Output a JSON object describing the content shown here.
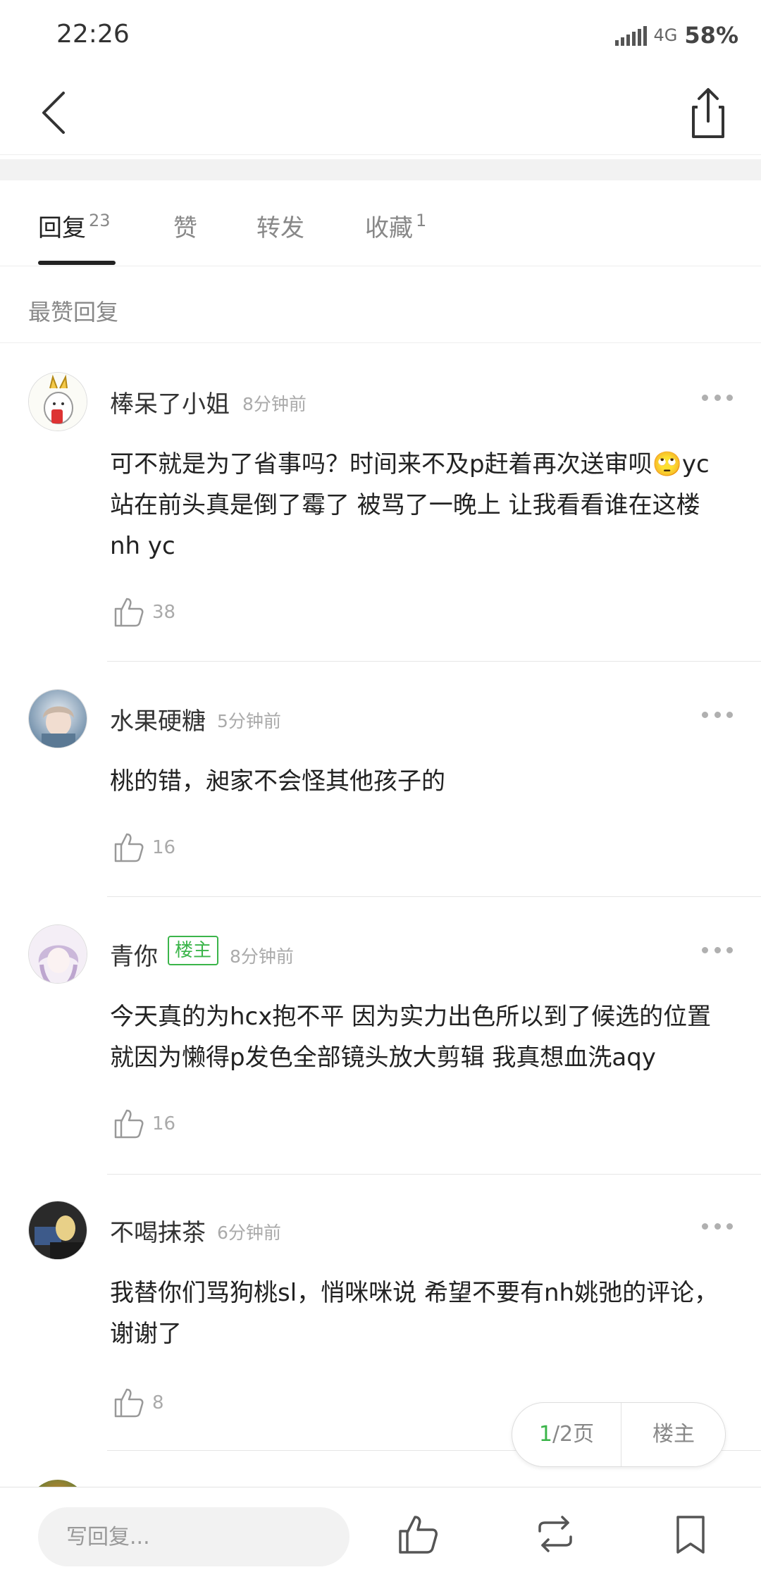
{
  "status": {
    "time": "22:26",
    "network": "4G",
    "battery": "58%"
  },
  "tabs": [
    {
      "label": "回复",
      "count": "23"
    },
    {
      "label": "赞",
      "count": ""
    },
    {
      "label": "转发",
      "count": ""
    },
    {
      "label": "收藏",
      "count": "1"
    }
  ],
  "section_title": "最赞回复",
  "comments": [
    {
      "name": "棒呆了小姐",
      "time": "8分钟前",
      "is_op": false,
      "text": "可不就是为了省事吗？时间来不及p赶着再次送审呗🙄yc站在前头真是倒了霉了 被骂了一晚上 让我看看谁在这楼nh yc",
      "likes": "38"
    },
    {
      "name": "水果硬糖",
      "time": "5分钟前",
      "is_op": false,
      "text": "桃的错，昶家不会怪其他孩子的",
      "likes": "16"
    },
    {
      "name": "青你",
      "time": "8分钟前",
      "is_op": true,
      "badge": "楼主",
      "text": "今天真的为hcx抱不平 因为实力出色所以到了候选的位置 就因为懒得p发色全部镜头放大剪辑 我真想血洗aqy",
      "likes": "16"
    },
    {
      "name": "不喝抹茶",
      "time": "6分钟前",
      "is_op": false,
      "text": "我替你们骂狗桃sl，悄咪咪说 希望不要有nh姚弛的评论，谢谢了",
      "likes": "8"
    }
  ],
  "pager": {
    "current": "1",
    "total": "/2页",
    "op_label": "楼主"
  },
  "bottom": {
    "reply_placeholder": "写回复..."
  },
  "colors": {
    "accent_green": "#3bb54a"
  }
}
